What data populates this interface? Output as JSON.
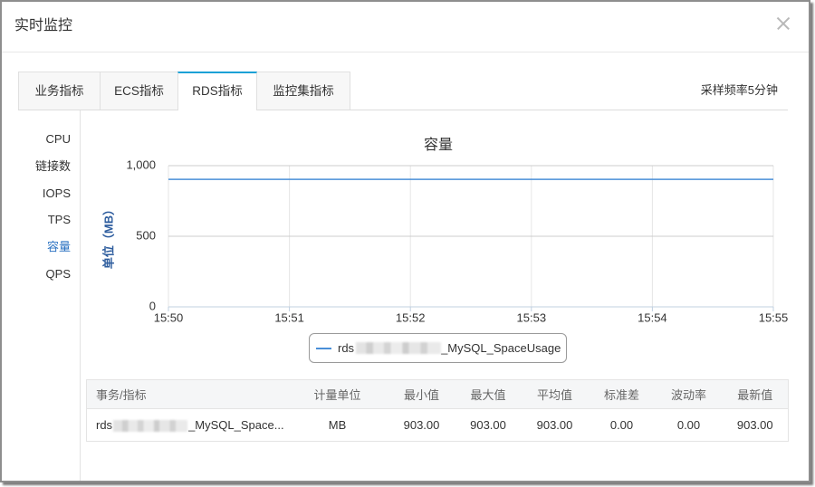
{
  "dialog": {
    "title": "实时监控",
    "close_icon": "close-icon"
  },
  "tabs": [
    {
      "label": "业务指标",
      "active": false
    },
    {
      "label": "ECS指标",
      "active": false
    },
    {
      "label": "RDS指标",
      "active": true
    },
    {
      "label": "监控集指标",
      "active": false
    }
  ],
  "sampling_rate": "采样频率5分钟",
  "sidebar": {
    "items": [
      {
        "label": "CPU",
        "active": false
      },
      {
        "label": "链接数",
        "active": false
      },
      {
        "label": "IOPS",
        "active": false
      },
      {
        "label": "TPS",
        "active": false
      },
      {
        "label": "容量",
        "active": true
      },
      {
        "label": "QPS",
        "active": false
      }
    ]
  },
  "theme": {
    "accent": "#1ba1d6",
    "active_item": "#2b72c2",
    "axis_title": "#2e5d9e"
  },
  "chart_data": {
    "type": "line",
    "title": "容量",
    "ylabel": "单位（MB）",
    "x": [
      "15:50",
      "15:51",
      "15:52",
      "15:53",
      "15:54",
      "15:55"
    ],
    "yticks": [
      0,
      500,
      1000
    ],
    "ytick_labels": [
      "0",
      "500",
      "1,000"
    ],
    "ylim": [
      0,
      1000
    ],
    "grid": true,
    "legend": "bottom-center",
    "series": [
      {
        "name_prefix": "rds",
        "name_redacted": true,
        "name_suffix": "_MySQL_SpaceUsage",
        "color": "#4a8fd8",
        "values": [
          903,
          903,
          903,
          903,
          903,
          903
        ]
      }
    ]
  },
  "table": {
    "columns": [
      "事务/指标",
      "计量单位",
      "最小值",
      "最大值",
      "平均值",
      "标准差",
      "波动率",
      "最新值"
    ],
    "rows": [
      {
        "metric_prefix": "rds",
        "metric_redacted": true,
        "metric_suffix": "_MySQL_Space...",
        "unit": "MB",
        "min": "903.00",
        "max": "903.00",
        "avg": "903.00",
        "std": "0.00",
        "volatility": "0.00",
        "latest": "903.00"
      }
    ]
  }
}
